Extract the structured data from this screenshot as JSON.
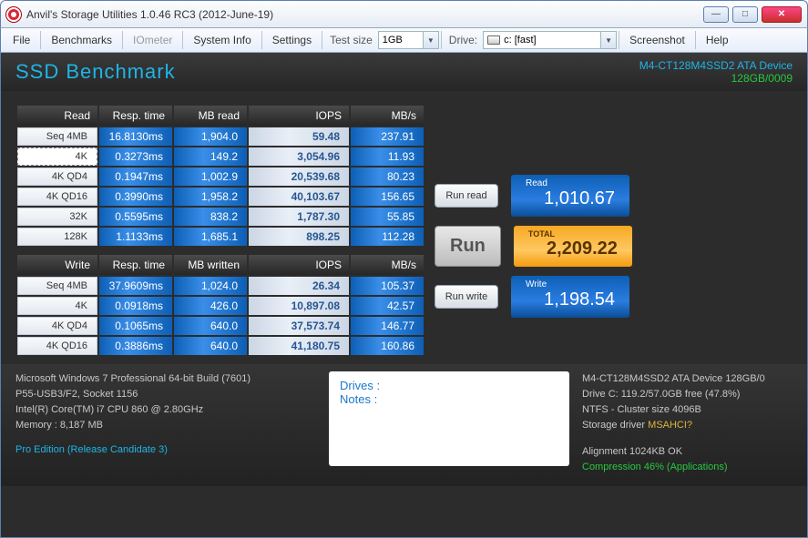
{
  "title": "Anvil's Storage Utilities 1.0.46 RC3 (2012-June-19)",
  "toolbar": {
    "file": "File",
    "benchmarks": "Benchmarks",
    "iometer": "IOmeter",
    "system_info": "System Info",
    "settings": "Settings",
    "test_size_label": "Test size",
    "test_size_value": "1GB",
    "drive_label": "Drive:",
    "drive_value": "c: [fast]",
    "screenshot": "Screenshot",
    "help": "Help"
  },
  "header": {
    "title": "SSD Benchmark",
    "device_line1": "M4-CT128M4SSD2 ATA Device",
    "device_line2": "128GB/0009"
  },
  "read": {
    "title": "Read",
    "cols": [
      "Resp. time",
      "MB read",
      "IOPS",
      "MB/s"
    ],
    "rows": [
      {
        "label": "Seq 4MB",
        "resp": "16.8130ms",
        "mb": "1,904.0",
        "iops": "59.48",
        "mbs": "237.91"
      },
      {
        "label": "4K",
        "resp": "0.3273ms",
        "mb": "149.2",
        "iops": "3,054.96",
        "mbs": "11.93",
        "sel": true
      },
      {
        "label": "4K QD4",
        "resp": "0.1947ms",
        "mb": "1,002.9",
        "iops": "20,539.68",
        "mbs": "80.23"
      },
      {
        "label": "4K QD16",
        "resp": "0.3990ms",
        "mb": "1,958.2",
        "iops": "40,103.67",
        "mbs": "156.65"
      },
      {
        "label": "32K",
        "resp": "0.5595ms",
        "mb": "838.2",
        "iops": "1,787.30",
        "mbs": "55.85"
      },
      {
        "label": "128K",
        "resp": "1.1133ms",
        "mb": "1,685.1",
        "iops": "898.25",
        "mbs": "112.28"
      }
    ]
  },
  "write": {
    "title": "Write",
    "cols": [
      "Resp. time",
      "MB written",
      "IOPS",
      "MB/s"
    ],
    "rows": [
      {
        "label": "Seq 4MB",
        "resp": "37.9609ms",
        "mb": "1,024.0",
        "iops": "26.34",
        "mbs": "105.37"
      },
      {
        "label": "4K",
        "resp": "0.0918ms",
        "mb": "426.0",
        "iops": "10,897.08",
        "mbs": "42.57"
      },
      {
        "label": "4K QD4",
        "resp": "0.1065ms",
        "mb": "640.0",
        "iops": "37,573.74",
        "mbs": "146.77"
      },
      {
        "label": "4K QD16",
        "resp": "0.3886ms",
        "mb": "640.0",
        "iops": "41,180.75",
        "mbs": "160.86"
      }
    ]
  },
  "side": {
    "run_read": "Run read",
    "run_write": "Run write",
    "run": "Run",
    "read_label": "Read",
    "read_score": "1,010.67",
    "write_label": "Write",
    "write_score": "1,198.54",
    "total_label": "TOTAL",
    "total_score": "2,209.22"
  },
  "footer": {
    "sys": [
      "Microsoft Windows 7 Professional  64-bit Build (7601)",
      "P55-USB3/F2, Socket 1156",
      "Intel(R) Core(TM) i7 CPU         860  @ 2.80GHz",
      "Memory : 8,187 MB"
    ],
    "pro": "Pro Edition (Release Candidate 3)",
    "notes_drives": "Drives :",
    "notes_notes": "Notes :",
    "drive": {
      "l1": "M4-CT128M4SSD2 ATA Device 128GB/0",
      "l2": "Drive C: 119.2/57.0GB free (47.8%)",
      "l3a": "NTFS - Cluster size 4096B",
      "l3b_pre": "Storage driver  ",
      "l3b_hl": "MSAHCI?",
      "l4": "Alignment 1024KB OK",
      "l5": "Compression 46% (Applications)"
    }
  }
}
